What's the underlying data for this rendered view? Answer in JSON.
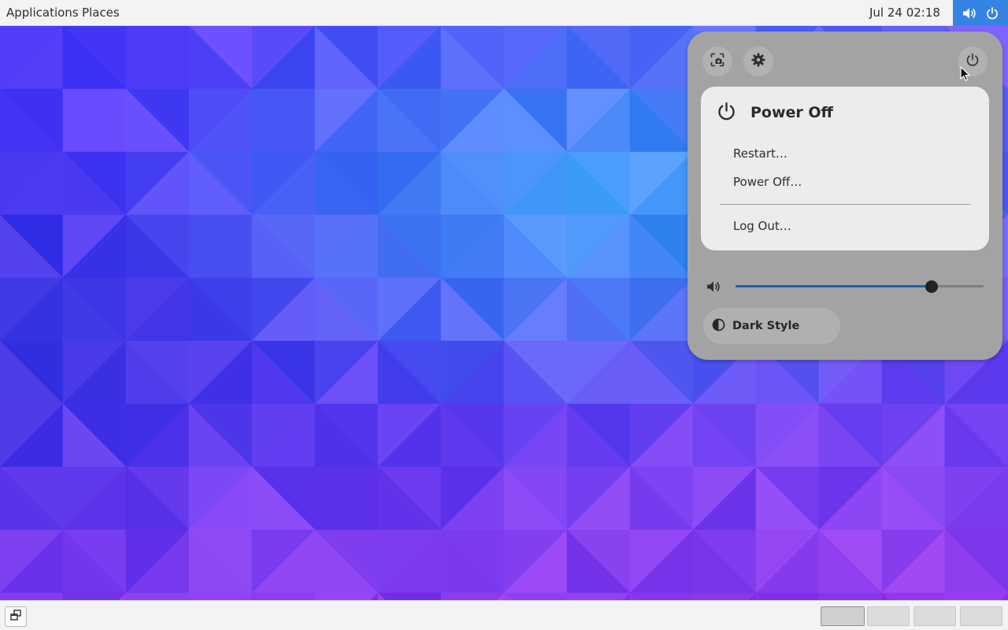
{
  "topbar": {
    "applications": "Applications",
    "places": "Places",
    "clock": "Jul 24  02:18",
    "status_icons": [
      "volume-icon",
      "power-icon"
    ],
    "status_bg": "#3584e4"
  },
  "quick_settings": {
    "buttons": [
      "screenshot-icon",
      "settings-icon",
      "power-icon"
    ],
    "power_menu": {
      "title": "Power Off",
      "items": [
        "Restart…",
        "Power Off…",
        "Log Out…"
      ]
    },
    "volume": {
      "level": 0.79
    },
    "dark_style": {
      "label": "Dark Style"
    }
  },
  "bottombar": {
    "workspaces": 4,
    "active_workspace": 1
  },
  "colors": {
    "accent": "#3584e4",
    "panel_bg": "#a3a3a3",
    "menu_bg": "#ececec"
  }
}
